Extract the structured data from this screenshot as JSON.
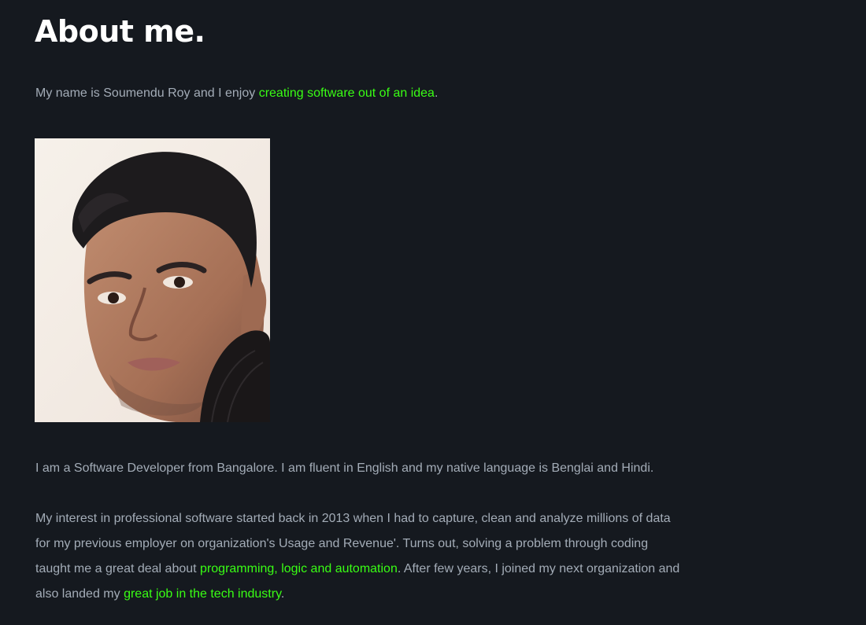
{
  "about": {
    "title": "About me.",
    "intro_prefix": "My name is Soumendu Roy and I enjoy ",
    "intro_highlight": "creating software out of an idea",
    "intro_suffix": ".",
    "photo_label": "Portrait photo",
    "p1": "I am a Software Developer from Bangalore. I am fluent in English and my native language is Benglai and Hindi.",
    "p2_part1": "My interest in professional software started back in 2013 when I had to capture, clean and analyze millions of data for my previous employer on organization's Usage and Revenue'. Turns out, solving a problem through coding taught me a great deal about ",
    "p2_highlight1": "programming, logic and automation",
    "p2_part2": ". After few years, I joined my next organization and also landed my ",
    "p2_highlight2": "great job in the tech industry",
    "p2_part3": "."
  },
  "colors": {
    "background": "#15191f",
    "text": "#a3acb7",
    "heading": "#ffffff",
    "highlight": "#39ff14"
  }
}
